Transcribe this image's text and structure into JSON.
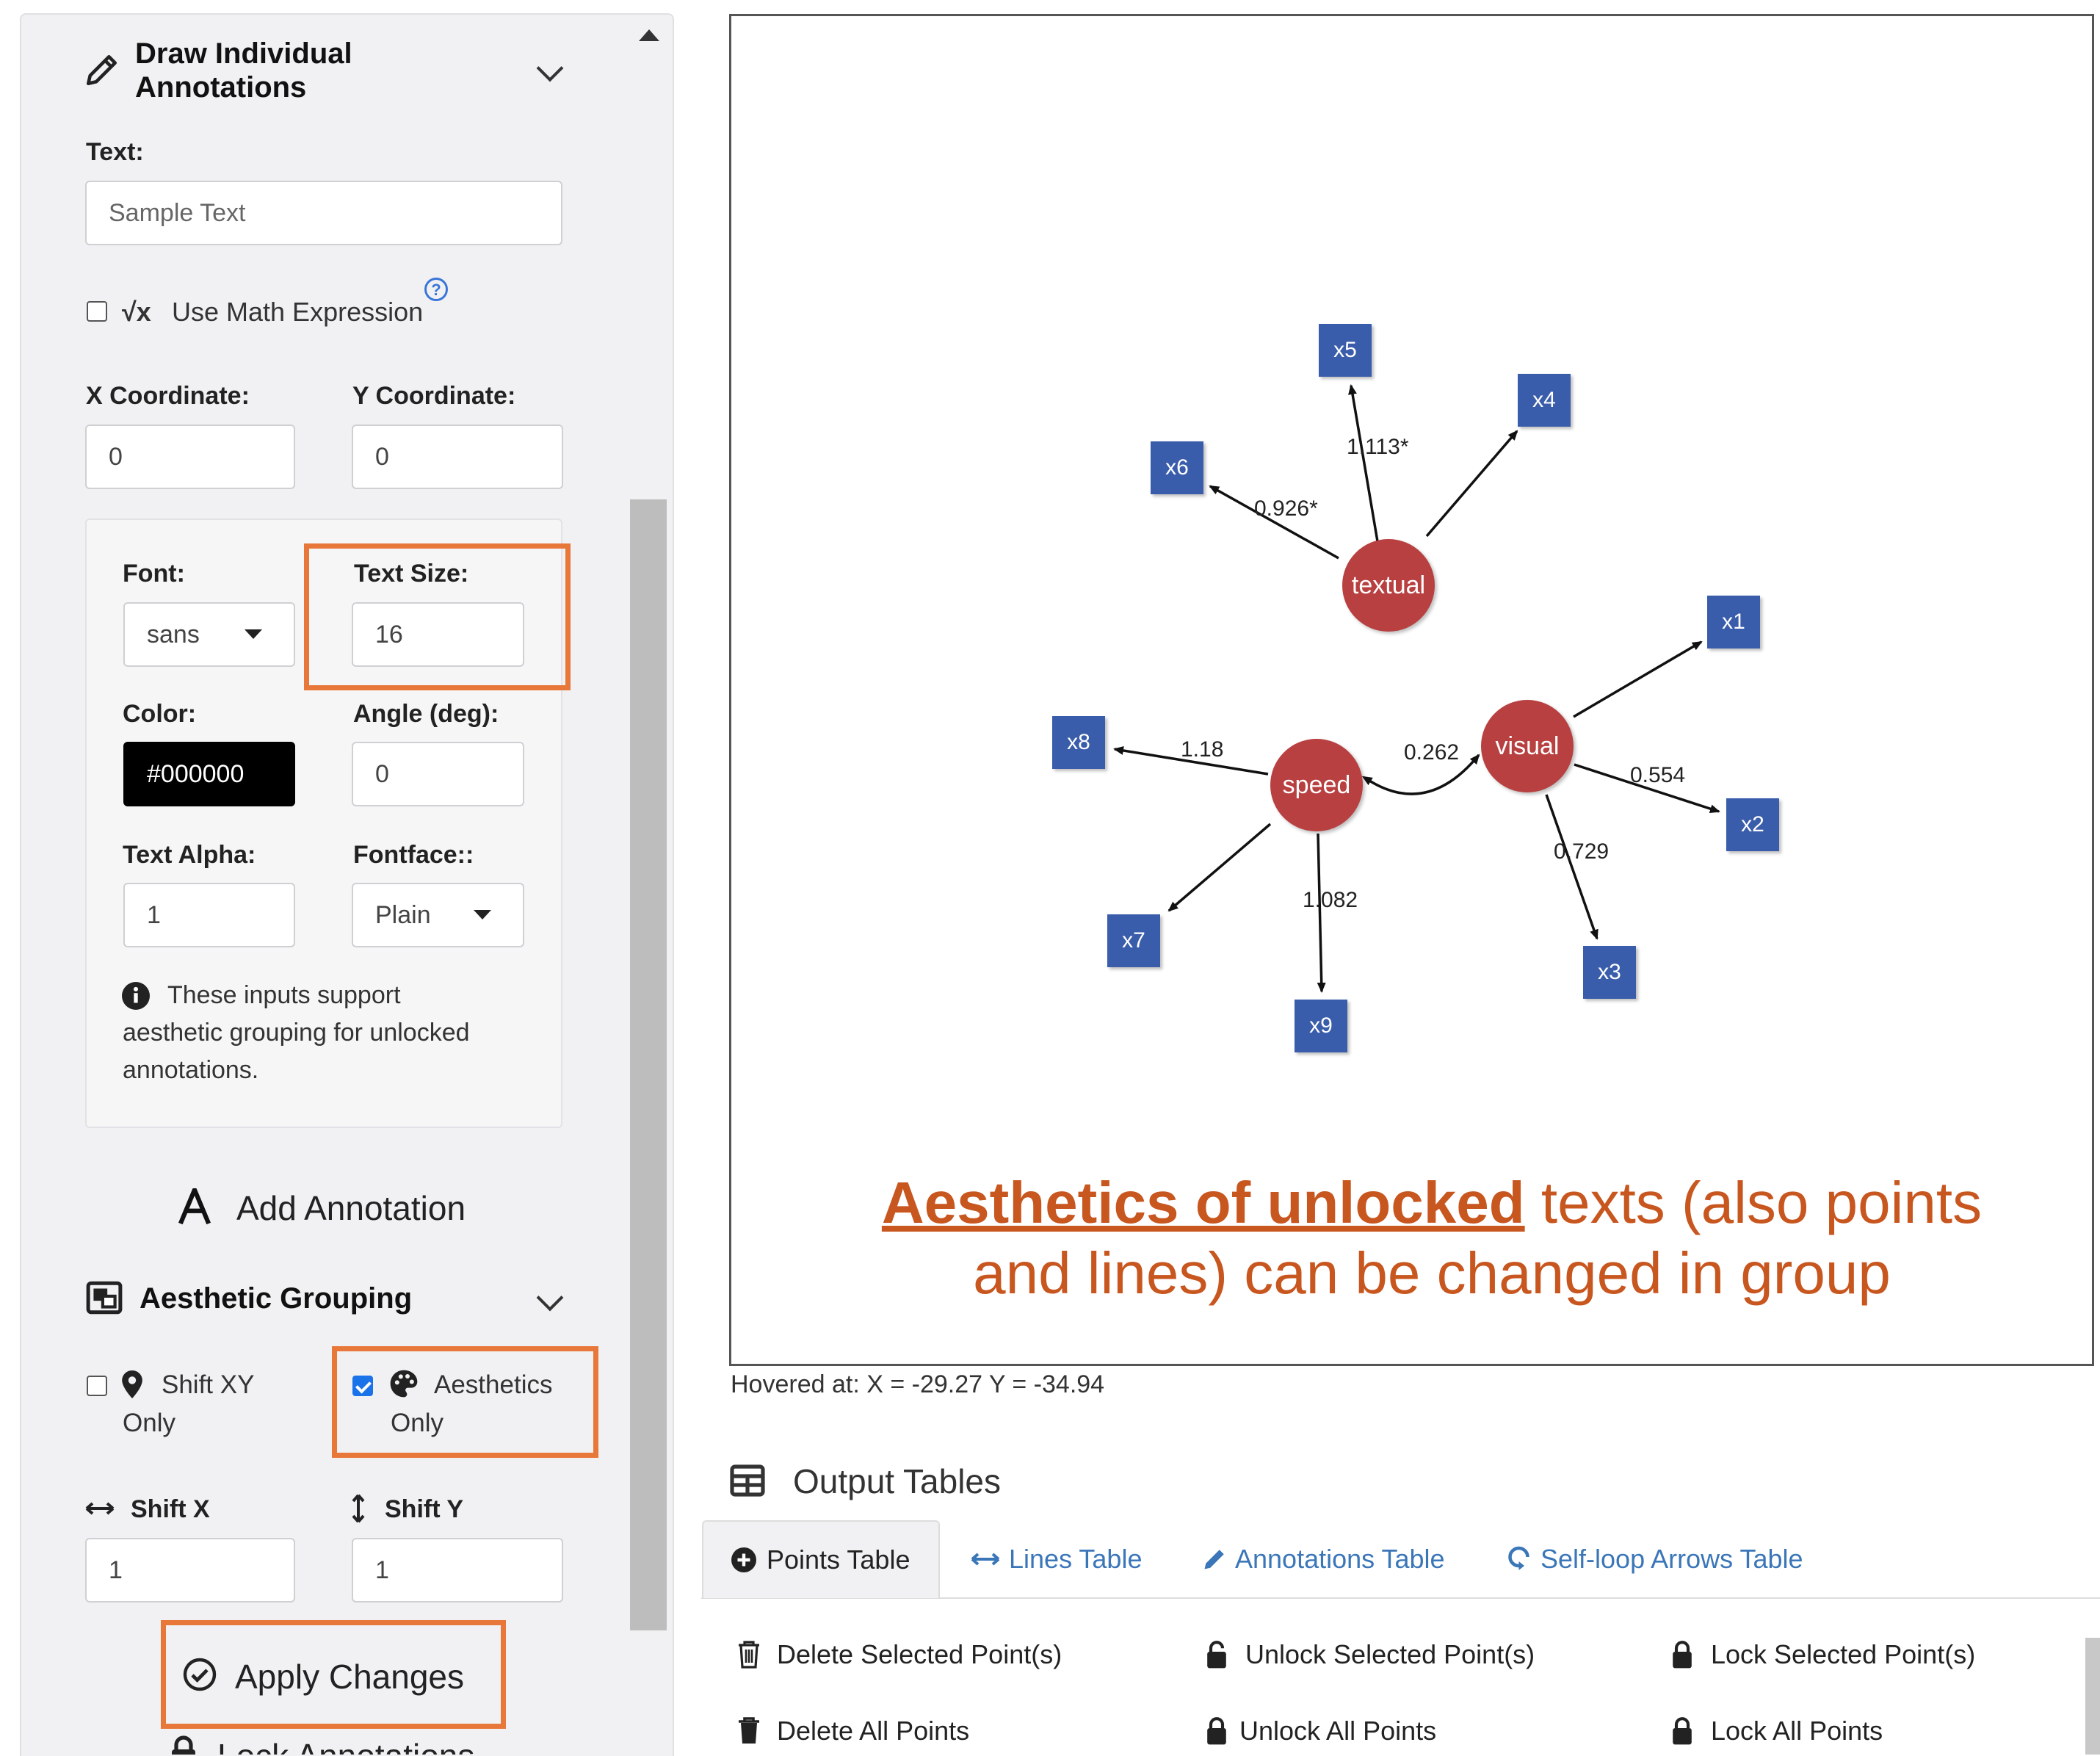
{
  "sidebar": {
    "draw_title_line1": "Draw Individual",
    "draw_title_line2": "Annotations",
    "text_label": "Text:",
    "text_placeholder": "Sample Text",
    "math_label": "Use Math Expression",
    "math_icon": "√x",
    "help_icon": "?",
    "x_label": "X Coordinate:",
    "y_label": "Y Coordinate:",
    "x_value": "0",
    "y_value": "0",
    "font_label": "Font:",
    "font_value": "sans",
    "text_size_label": "Text Size:",
    "text_size_value": "16",
    "color_label": "Color:",
    "color_value": "#000000",
    "angle_label": "Angle (deg):",
    "angle_value": "0",
    "alpha_label": "Text Alpha:",
    "alpha_value": "1",
    "fontface_label": "Fontface::",
    "fontface_value": "Plain",
    "info_line1": "These inputs support",
    "info_line2": "aesthetic grouping for unlocked",
    "info_line3": "annotations.",
    "add_annotation": "Add Annotation",
    "grouping_title": "Aesthetic Grouping",
    "shift_xy_line1": "Shift XY",
    "shift_xy_line2": "Only",
    "aesthetics_line1": "Aesthetics",
    "aesthetics_line2": "Only",
    "shift_x_label": "Shift X",
    "shift_y_label": "Shift Y",
    "shift_x_value": "1",
    "shift_y_value": "1",
    "apply_changes": "Apply Changes",
    "lock_annotations": "Lock Annotations"
  },
  "plot": {
    "nodes": {
      "x1": "x1",
      "x2": "x2",
      "x3": "x3",
      "x4": "x4",
      "x5": "x5",
      "x6": "x6",
      "x7": "x7",
      "x8": "x8",
      "x9": "x9",
      "textual": "textual",
      "visual": "visual",
      "speed": "speed"
    },
    "edge_labels": {
      "x5": "1.113*",
      "x6": "0.926*",
      "x8": "1.18",
      "corr": "0.262",
      "x2": "0.554",
      "x3": "0.729",
      "x9": "1.082"
    },
    "caption_emph": "Aesthetics of unlocked",
    "caption_rest1": " texts (also points",
    "caption_line2": "and lines) can be changed in group",
    "hover": "Hovered at: X = -29.27 Y = -34.94",
    "colors": {
      "latent": "#b84040",
      "observed": "#3a5dab",
      "caption": "#c8561f",
      "highlight": "#e8783a"
    }
  },
  "output": {
    "title": "Output Tables",
    "tabs": [
      "Points Table",
      "Lines Table",
      "Annotations Table",
      "Self-loop Arrows Table"
    ],
    "actions": {
      "delete_selected": "Delete Selected Point(s)",
      "unlock_selected": "Unlock Selected Point(s)",
      "lock_selected": "Lock Selected Point(s)",
      "delete_all": "Delete All Points",
      "unlock_all": "Unlock All Points",
      "lock_all": "Lock All Points"
    }
  }
}
